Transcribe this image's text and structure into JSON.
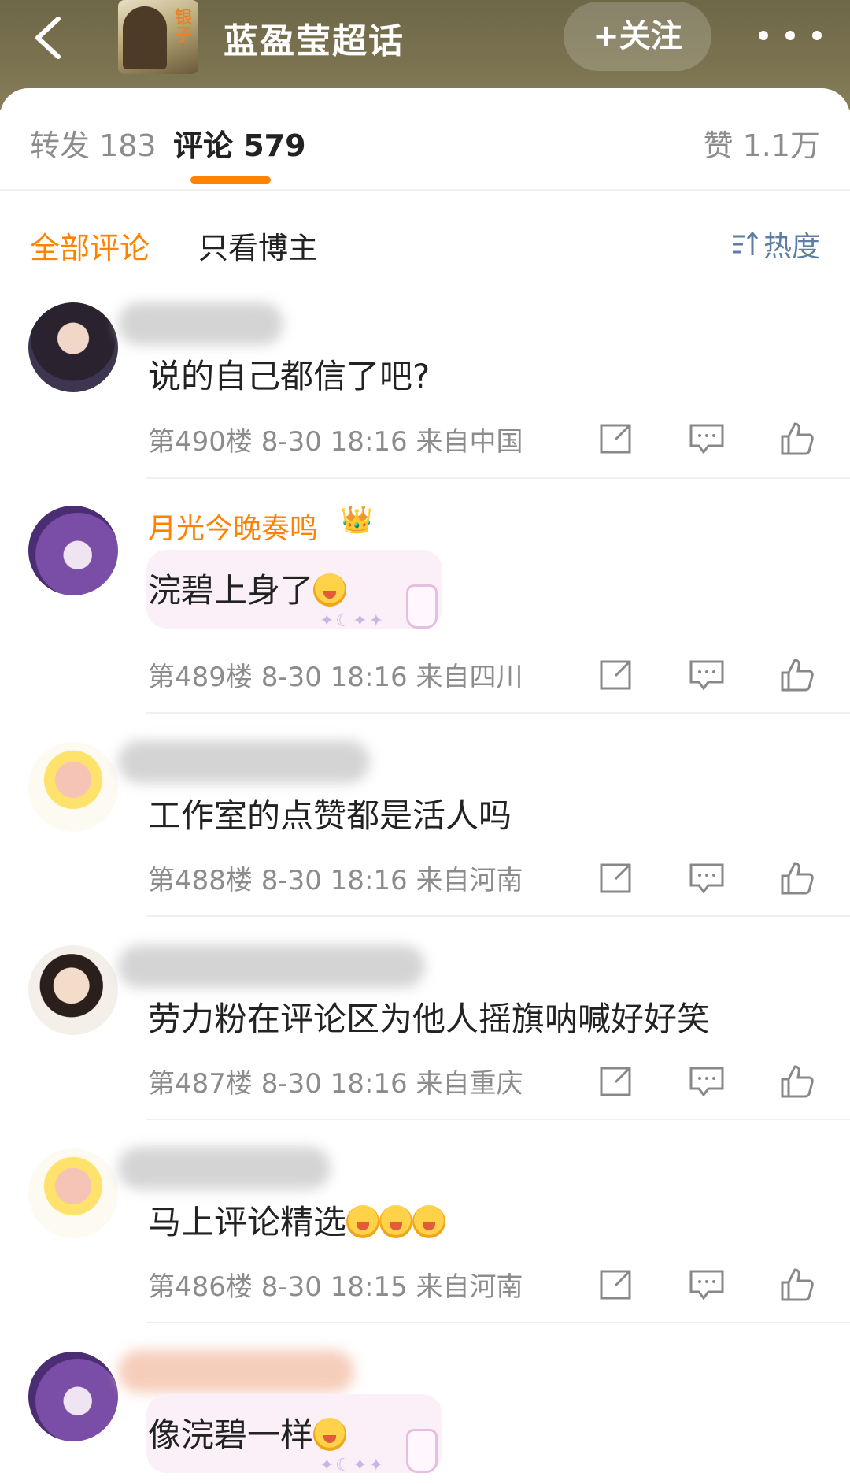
{
  "header": {
    "topic_title": "蓝盈莹超话",
    "cover_text": "银子",
    "follow_label": "+关注"
  },
  "tabs": {
    "reposts": "转发 183",
    "comments": "评论 579",
    "likes": "赞 1.1万"
  },
  "filters": {
    "all": "全部评论",
    "author_only": "只看博主",
    "sort": "热度"
  },
  "comments": [
    {
      "name": "",
      "text": "说的自己都信了吧?",
      "meta": "第490楼 8-30 18:16 来自中国"
    },
    {
      "name": "月光今晚奏鸣",
      "text": "浣碧上身了",
      "meta": "第489楼 8-30 18:16 来自四川"
    },
    {
      "name": "",
      "text": "工作室的点赞都是活人吗",
      "meta": "第488楼 8-30 18:16 来自河南"
    },
    {
      "name": "",
      "text": "劳力粉在评论区为他人摇旗呐喊好好笑",
      "meta": "第487楼 8-30 18:16 来自重庆"
    },
    {
      "name": "",
      "text": "马上评论精选",
      "meta": "第486楼 8-30 18:15 来自河南"
    },
    {
      "name": "",
      "text": "像浣碧一样",
      "meta": ""
    }
  ],
  "icons": {
    "share": "share-icon",
    "reply": "reply-icon",
    "like": "like-icon"
  },
  "colors": {
    "accent": "#ff8200",
    "link": "#5d7da4",
    "header_bg": "#7a724f"
  }
}
